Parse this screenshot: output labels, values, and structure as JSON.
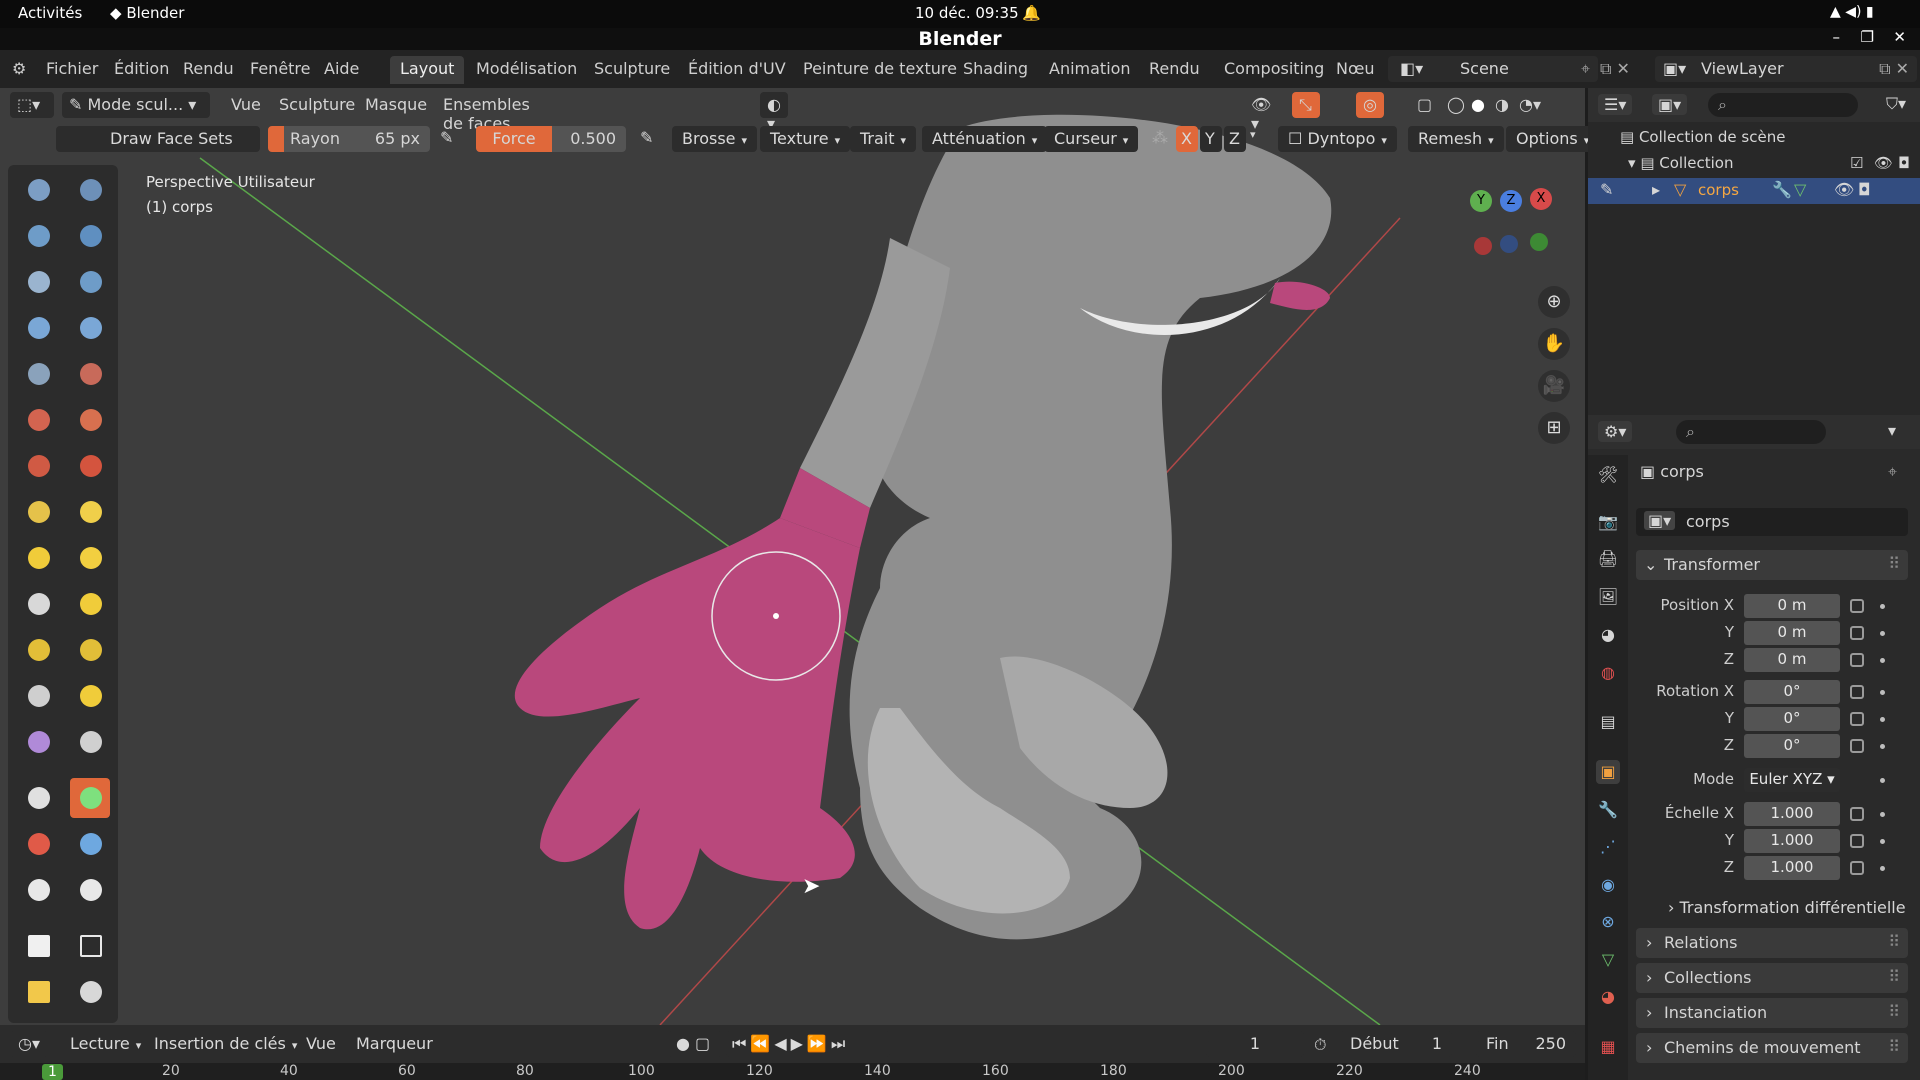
{
  "system_bar": {
    "activities": "Activités",
    "app": "Blender",
    "datetime": "10 déc.  09:35"
  },
  "window_title": "Blender",
  "menu": [
    "Fichier",
    "Édition",
    "Rendu",
    "Fenêtre",
    "Aide"
  ],
  "workspace_tabs": [
    "Layout",
    "Modélisation",
    "Sculpture",
    "Édition d'UV",
    "Peinture de texture",
    "Shading",
    "Animation",
    "Rendu",
    "Compositing",
    "Nœu"
  ],
  "active_tab": "Layout",
  "scene": "Scene",
  "view_layer": "ViewLayer",
  "viewport_header": {
    "mode": "Mode scul...",
    "items": [
      "Vue",
      "Sculpture",
      "Masque",
      "Ensembles de faces"
    ]
  },
  "tool_header": {
    "tool_name": "Draw Face Sets",
    "radius_label": "Rayon",
    "radius_value": "65 px",
    "force_label": "Force",
    "force_value": "0.500",
    "dropdowns": [
      "Brosse",
      "Texture",
      "Trait",
      "Atténuation",
      "Curseur"
    ],
    "axes": [
      "X",
      "Y",
      "Z"
    ],
    "dyntopo": "Dyntopo",
    "remesh": "Remesh",
    "options": "Options"
  },
  "viewport_overlay": {
    "view": "Perspective Utilisateur",
    "object": "(1) corps"
  },
  "gizmo": {
    "x": "X",
    "y": "Y",
    "z": "Z"
  },
  "outliner": {
    "scene_collection": "Collection de scène",
    "collection": "Collection",
    "object": "corps"
  },
  "properties": {
    "object_name": "corps",
    "datablock": "corps",
    "transform_title": "Transformer",
    "position_label": "Position X",
    "position": [
      "0 m",
      "0 m",
      "0 m"
    ],
    "rotation_label": "Rotation X",
    "rotation": [
      "0°",
      "0°",
      "0°"
    ],
    "mode_label": "Mode",
    "mode_value": "Euler XYZ",
    "scale_label": "Échelle X",
    "scale": [
      "1.000",
      "1.000",
      "1.000"
    ],
    "axis_y": "Y",
    "axis_z": "Z",
    "delta": "Transformation différentielle",
    "sections": [
      "Relations",
      "Collections",
      "Instanciation",
      "Chemins de mouvement"
    ]
  },
  "timeline": {
    "menus": [
      "Lecture",
      "Insertion de clés",
      "Vue",
      "Marqueur"
    ],
    "current_frame": "1",
    "start_label": "Début",
    "start": "1",
    "end_label": "Fin",
    "end": "250",
    "ruler": [
      "1",
      "20",
      "40",
      "60",
      "80",
      "100",
      "120",
      "140",
      "160",
      "180",
      "200",
      "220",
      "240"
    ]
  },
  "colors": {
    "accent": "#e0683a",
    "mask": "#b9487c",
    "viewport": "#3d3d3d"
  }
}
